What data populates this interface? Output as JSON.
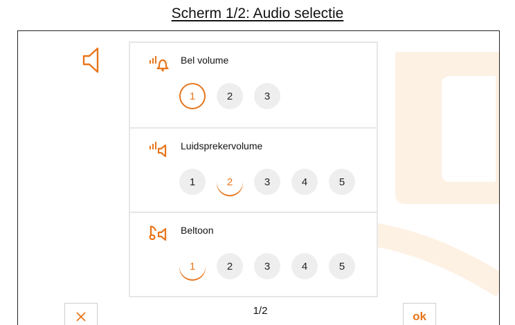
{
  "page_title": "Scherm 1/2: Audio selectie",
  "colors": {
    "accent": "#e8751a",
    "option_bg": "#eeeeee",
    "divider": "#e6e6e6"
  },
  "header_icon": "speaker-icon",
  "sections": [
    {
      "label": "Bel volume",
      "icon": "bell-volume-icon",
      "options": [
        "1",
        "2",
        "3"
      ],
      "selected": "1"
    },
    {
      "label": "Luidsprekervolume",
      "icon": "speaker-volume-icon",
      "options": [
        "1",
        "2",
        "3",
        "4",
        "5"
      ],
      "selected": "2"
    },
    {
      "label": "Beltoon",
      "icon": "ringtone-icon",
      "options": [
        "1",
        "2",
        "3",
        "4",
        "5"
      ],
      "selected": "1"
    }
  ],
  "footer": {
    "page_indicator": "1/2",
    "cancel_icon": "close-icon",
    "ok_label": "ok"
  }
}
